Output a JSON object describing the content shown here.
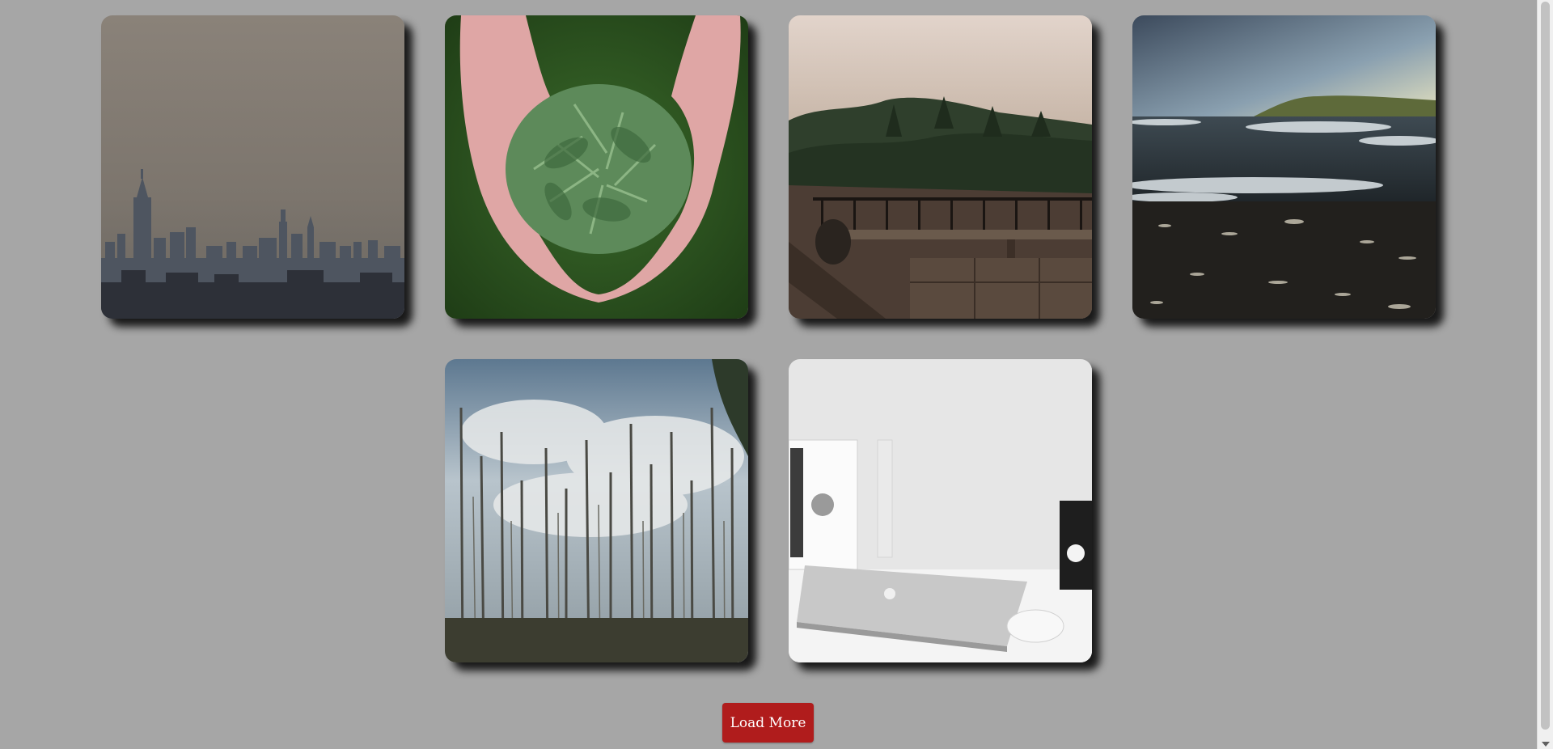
{
  "gallery": {
    "images": [
      {
        "name": "city-skyline-photo"
      },
      {
        "name": "hands-holding-pine-tips-photo"
      },
      {
        "name": "foggy-forest-overlook-photo"
      },
      {
        "name": "ocean-waves-beach-photo"
      },
      {
        "name": "bare-trees-forest-photo"
      },
      {
        "name": "laptop-desk-photo"
      }
    ]
  },
  "actions": {
    "load_more_label": "Load More"
  },
  "colors": {
    "background": "#a6a6a6",
    "button": "#b01c1c",
    "button_text": "#ffffff"
  }
}
